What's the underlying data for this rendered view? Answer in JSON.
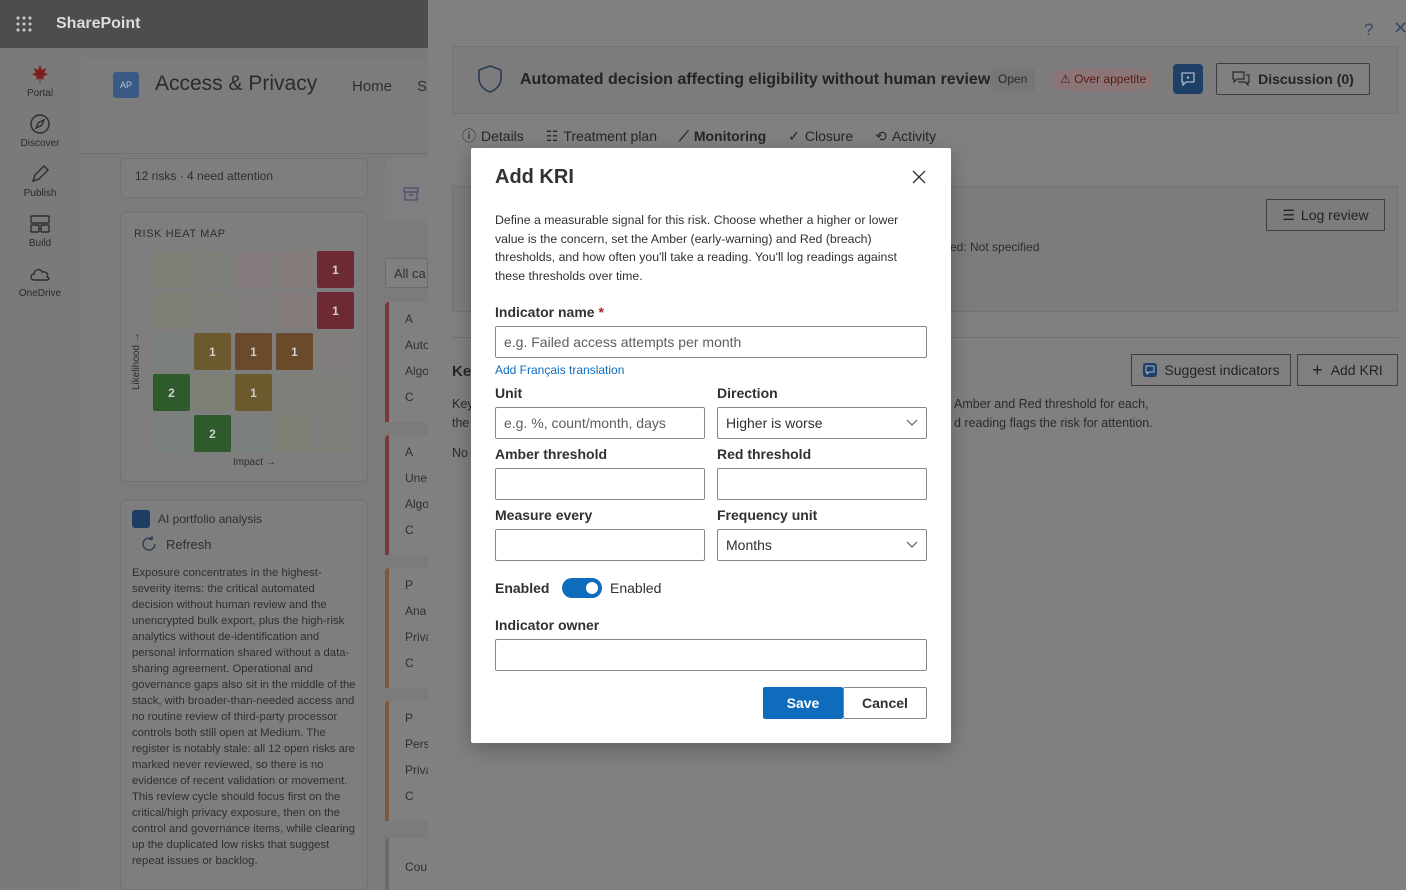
{
  "suite": {
    "title": "SharePoint"
  },
  "appbar": {
    "items": [
      {
        "label": "Portal",
        "icon": "maple-leaf-icon"
      },
      {
        "label": "Discover",
        "icon": "compass-icon"
      },
      {
        "label": "Publish",
        "icon": "pen-icon"
      },
      {
        "label": "Build",
        "icon": "layout-icon"
      },
      {
        "label": "OneDrive",
        "icon": "cloud-icon"
      }
    ]
  },
  "site": {
    "logo": "AP",
    "title": "Access & Privacy",
    "nav": [
      "Home",
      "Si"
    ]
  },
  "summary": {
    "text": "12 risks · 4 need attention"
  },
  "heatmap": {
    "title": "RISK HEAT MAP",
    "y_label": "Likelihood →",
    "x_label": "Impact →",
    "rows": [
      [
        "",
        "",
        "",
        "",
        "1"
      ],
      [
        "",
        "",
        "",
        "",
        "1"
      ],
      [
        "",
        "1",
        "1",
        "1",
        ""
      ],
      [
        "2",
        "",
        "1",
        "",
        ""
      ],
      [
        "",
        "2",
        "",
        "",
        ""
      ]
    ]
  },
  "ai": {
    "title": "AI portfolio analysis",
    "refresh": "Refresh",
    "text": "Exposure concentrates in the highest-severity items: the critical automated decision without human review and the unencrypted bulk export, plus the high-risk analytics without de-identification and personal information shared without a data-sharing agreement. Operational and governance gaps also sit in the middle of the stack, with broader-than-needed access and no routine review of third-party processor controls both still open at Medium. The register is notably stale: all 12 open risks are marked never reviewed, so there is no evidence of recent validation or movement. This review cycle should focus first on the critical/high privacy exposure, then on the control and governance items, while clearing up the duplicated low risks that suggest repeat issues or backlog."
  },
  "list": {
    "filter": "All ca",
    "cards": [
      {
        "a": "A",
        "b": "Auto",
        "c": "Algo",
        "d": "C"
      },
      {
        "a": "A",
        "b": "Une",
        "c": "Algo",
        "d": "C"
      },
      {
        "a": "P",
        "b": "Ana",
        "c": "Priva",
        "d": "C"
      },
      {
        "a": "P",
        "b": "Pers",
        "c": "Priva",
        "d": "C"
      },
      {
        "a": "",
        "b": "Cou",
        "c": "",
        "d": ""
      }
    ]
  },
  "panel": {
    "help": "?",
    "risk_title": "Automated decision affecting eligibility without human review",
    "status": "Open",
    "appetite": "Over appetite",
    "discussion": "Discussion (0)",
    "tabs": [
      {
        "label": "Details",
        "icon": "info-icon"
      },
      {
        "label": "Treatment plan",
        "icon": "list-icon"
      },
      {
        "label": "Monitoring",
        "icon": "chart-icon",
        "active": true
      },
      {
        "label": "Closure",
        "icon": "check-circle-icon"
      },
      {
        "label": "Activity",
        "icon": "history-icon"
      }
    ],
    "log_review": "Log review",
    "not_specified": "ed: Not specified",
    "key_label": "Key",
    "suggest": "Suggest indicators",
    "add_kri": "Add KRI",
    "kri_desc_1": "Amber and Red threshold for each,",
    "kri_desc_2": "d reading flags the risk for attention.",
    "key_left_1": "Key",
    "key_left_2": "the",
    "no_left": "No"
  },
  "dialog": {
    "title": "Add KRI",
    "description": "Define a measurable signal for this risk. Choose whether a higher or lower value is the concern, set the Amber (early-warning) and Red (breach) thresholds, and how often you'll take a reading. You'll log readings against these thresholds over time.",
    "indicator_name_label": "Indicator name",
    "required_mark": "*",
    "indicator_name_placeholder": "e.g. Failed access attempts per month",
    "translation_link": "Add Français translation",
    "unit_label": "Unit",
    "unit_placeholder": "e.g. %, count/month, days",
    "direction_label": "Direction",
    "direction_value": "Higher is worse",
    "amber_label": "Amber threshold",
    "red_label": "Red threshold",
    "measure_label": "Measure every",
    "frequency_label": "Frequency unit",
    "frequency_value": "Months",
    "enabled_label": "Enabled",
    "enabled_state": "Enabled",
    "owner_label": "Indicator owner",
    "save": "Save",
    "cancel": "Cancel"
  }
}
